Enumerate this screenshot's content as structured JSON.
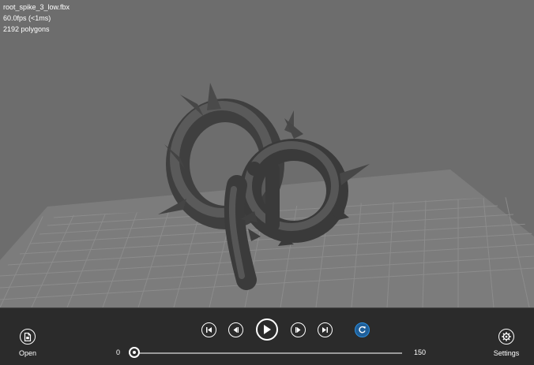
{
  "viewport": {
    "stats": {
      "filename": "root_spike_3_low.fbx",
      "fps": "60.0fps (<1ms)",
      "polygons": "2192 polygons"
    },
    "background_color": "#6d6d6d"
  },
  "appbar": {
    "open_label": "Open",
    "settings_label": "Settings",
    "transport": {
      "first_icon": "skip-to-start-icon",
      "prev_icon": "step-back-icon",
      "play_icon": "play-icon",
      "next_icon": "step-forward-icon",
      "last_icon": "skip-to-end-icon",
      "loop_icon": "loop-icon",
      "loop_color": "#2b8fe0"
    },
    "timeline": {
      "min": "0",
      "max": "150",
      "current_fraction": 0.0
    }
  }
}
